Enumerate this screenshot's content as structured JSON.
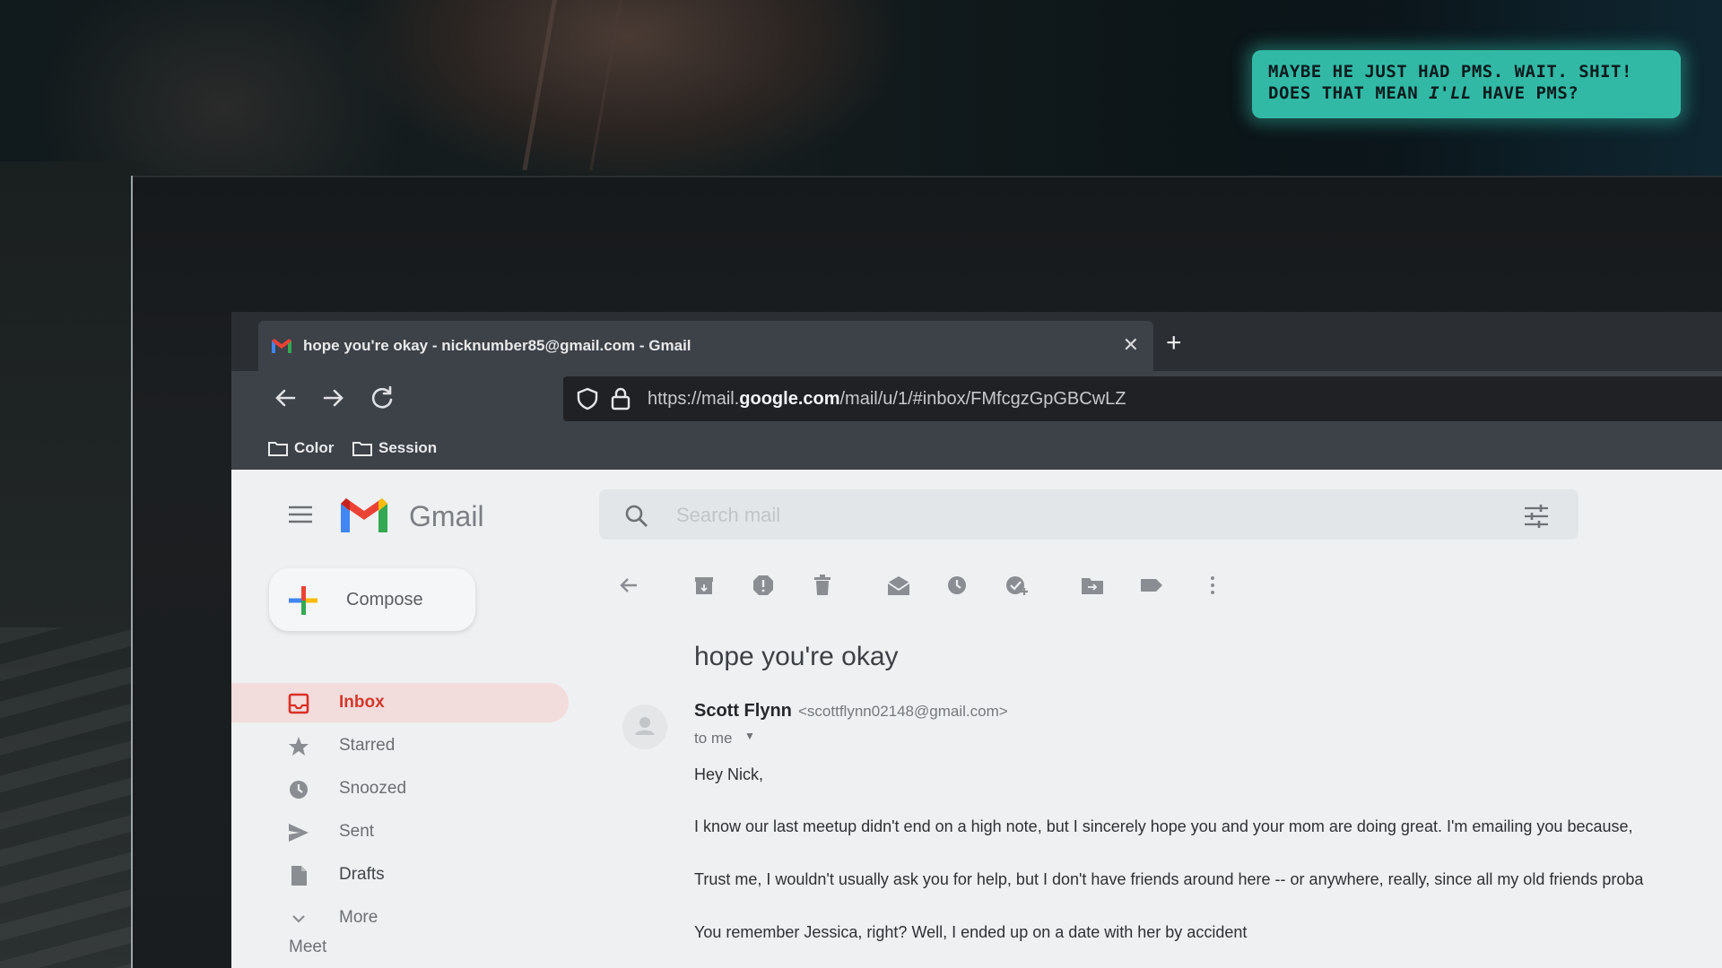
{
  "caption": {
    "line1": "MAYBE HE JUST HAD PMS. WAIT. SHIT!",
    "line2_a": "DOES THAT MEAN ",
    "line2_em": "I'LL",
    "line2_b": " HAVE PMS?"
  },
  "browser": {
    "tab_title": "hope you're okay - nicknumber85@gmail.com - Gmail",
    "tab_close": "✕",
    "new_tab": "+",
    "url_prefix": "https://mail.",
    "url_domain": "google.com",
    "url_suffix": "/mail/u/1/#inbox/FMfcgzGpGBCwLZ",
    "bookmarks": [
      "Color",
      "Session"
    ]
  },
  "gmail": {
    "brand": "Gmail",
    "search_placeholder": "Search mail",
    "compose": "Compose",
    "nav": [
      {
        "label": "Inbox",
        "icon": "inbox-icon"
      },
      {
        "label": "Starred",
        "icon": "star-icon"
      },
      {
        "label": "Snoozed",
        "icon": "clock-icon"
      },
      {
        "label": "Sent",
        "icon": "send-icon"
      },
      {
        "label": "Drafts",
        "icon": "draft-icon"
      },
      {
        "label": "More",
        "icon": "chevron-down-icon"
      }
    ],
    "meet": "Meet",
    "colors": {
      "accent": "#d93025",
      "inbox_bg": "#f3dcdc"
    }
  },
  "email": {
    "subject": "hope you're okay",
    "sender_name": "Scott Flynn",
    "sender_email": "<scottflynn02148@gmail.com>",
    "to": "to me",
    "greeting": "Hey Nick,",
    "para1": "I know our last meetup didn't end on a high note, but I sincerely hope you and your mom are doing great. I'm emailing you because,",
    "para2": "Trust me, I wouldn't usually ask you for help, but I don't have friends around here -- or anywhere, really, since all my old friends proba",
    "para3": "You remember Jessica, right? Well, I ended up on a date with her by accident"
  }
}
